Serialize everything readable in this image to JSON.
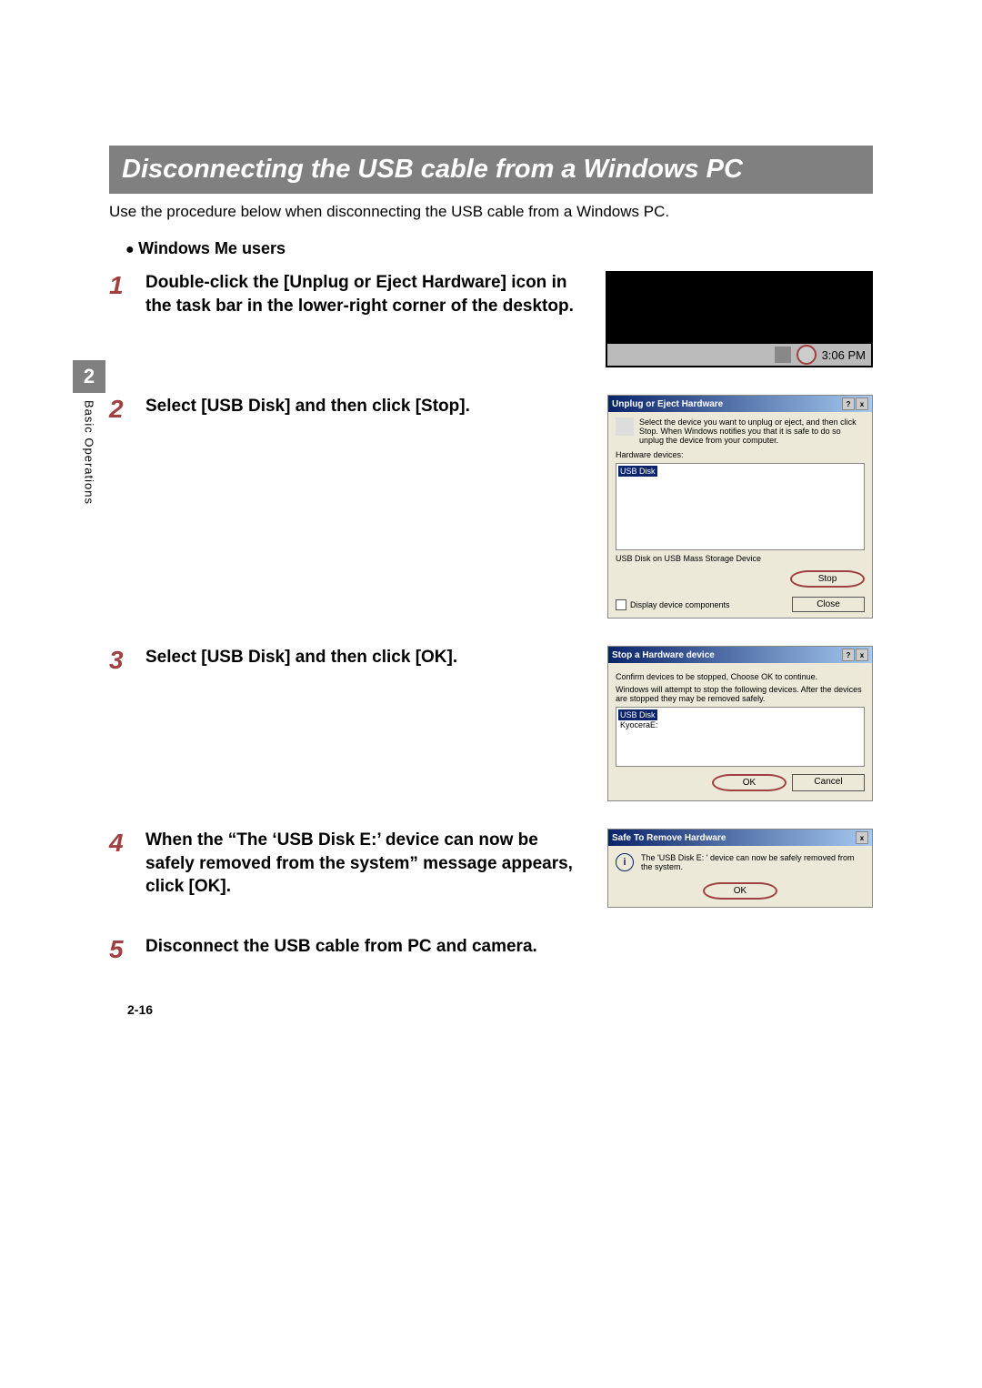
{
  "sidebar": {
    "chapter_num": "2",
    "chapter_label": "Basic Operations"
  },
  "section_title": "Disconnecting the USB cable from a Windows PC",
  "intro": "Use the procedure below when disconnecting the USB cable from a Windows PC.",
  "subhead": "Windows Me users",
  "steps": {
    "s1": {
      "num": "1",
      "text": "Double-click the [Unplug or Eject Hardware] icon in the task bar in the lower-right corner of the desktop."
    },
    "s2": {
      "num": "2",
      "text": "Select [USB Disk] and then click [Stop]."
    },
    "s3": {
      "num": "3",
      "text": "Select [USB Disk] and then click [OK]."
    },
    "s4": {
      "num": "4",
      "text": "When the “The ‘USB Disk E:’ device can now be safely removed from the system” message appears, click [OK]."
    },
    "s5": {
      "num": "5",
      "text": "Disconnect the USB cable from PC and camera."
    }
  },
  "taskbar": {
    "clock": "3:06 PM"
  },
  "unplug_dialog": {
    "title": "Unplug or Eject Hardware",
    "message": "Select the device you want to unplug or eject, and then click Stop. When Windows notifies you that it is safe to do so unplug the device from your computer.",
    "list_label": "Hardware devices:",
    "item1": "USB Disk",
    "status": "USB Disk on USB Mass Storage Device",
    "stop_btn": "Stop",
    "close_btn": "Close",
    "checkbox_label": "Display device components"
  },
  "stop_dialog": {
    "title": "Stop a Hardware device",
    "line1": "Confirm devices to be stopped, Choose OK to continue.",
    "line2": "Windows will attempt to stop the following devices. After the devices are stopped they may be removed safely.",
    "item1": "USB Disk",
    "item2": "KyoceraE:",
    "ok_btn": "OK",
    "cancel_btn": "Cancel"
  },
  "safe_dialog": {
    "title": "Safe To Remove Hardware",
    "message": "The 'USB Disk E: ' device can now be safely removed from the system.",
    "ok_btn": "OK"
  },
  "page_number": "2-16",
  "win_help": "?",
  "win_close": "x"
}
